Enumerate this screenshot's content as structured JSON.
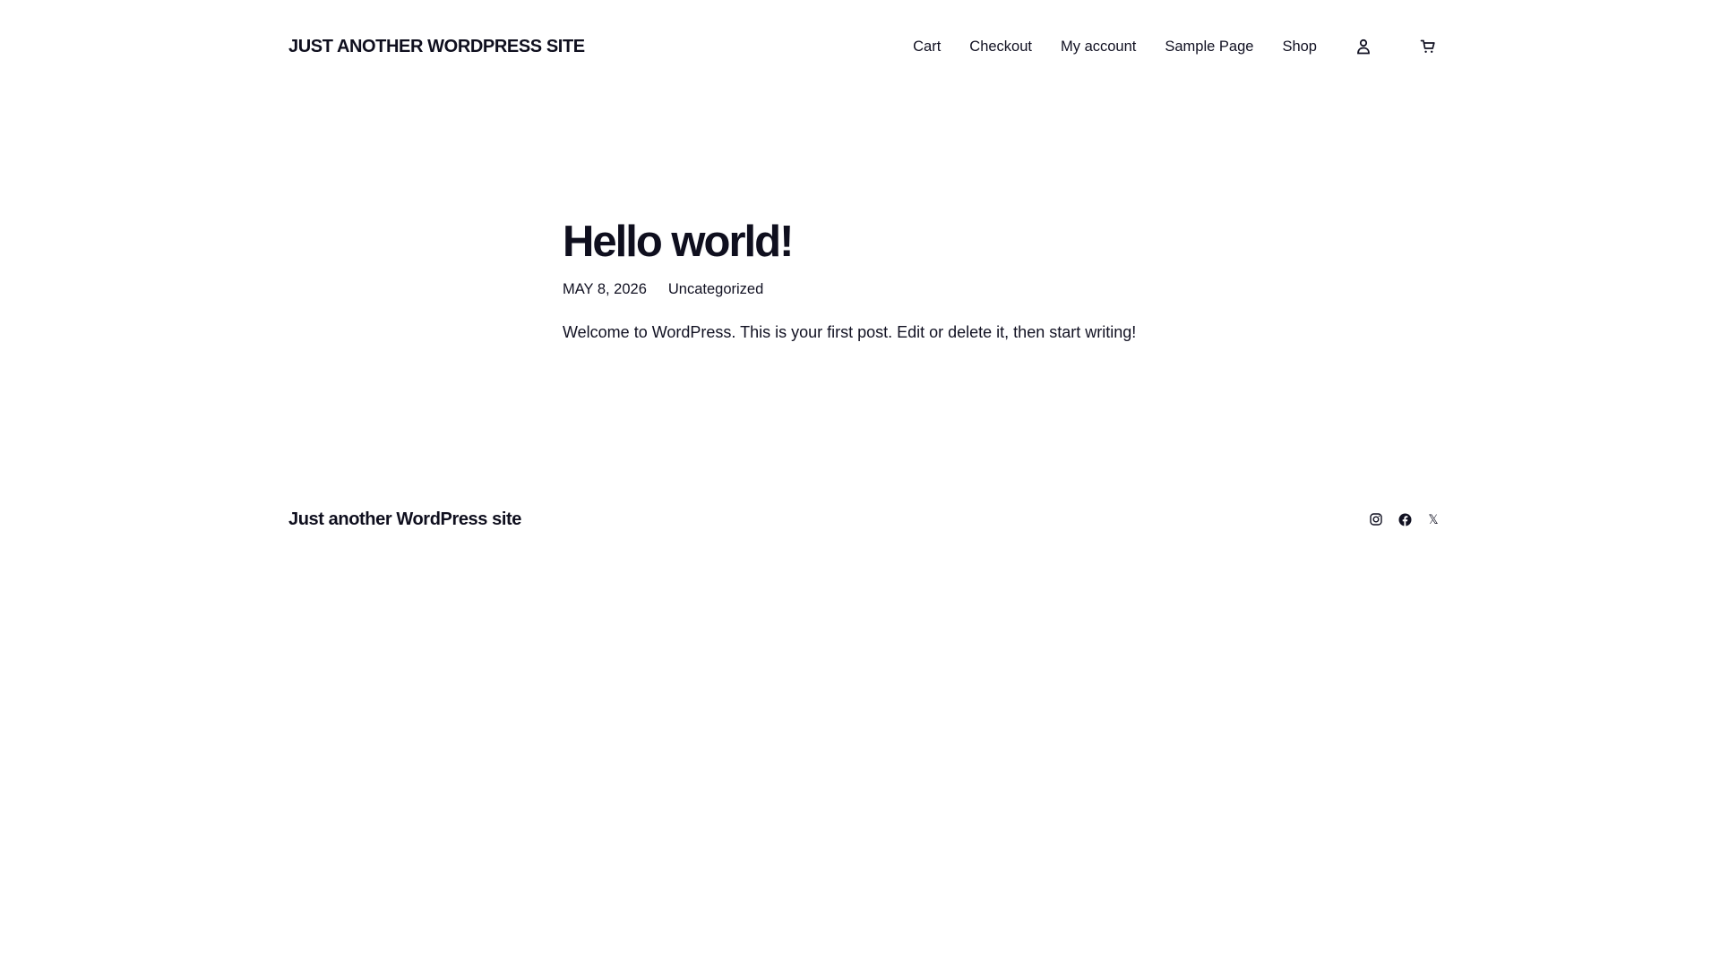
{
  "header": {
    "site_title": "JUST ANOTHER WORDPRESS SITE",
    "nav": [
      {
        "label": "Cart"
      },
      {
        "label": "Checkout"
      },
      {
        "label": "My account"
      },
      {
        "label": "Sample Page"
      },
      {
        "label": "Shop"
      }
    ],
    "icons": {
      "account": "user-icon",
      "cart": "cart-icon"
    }
  },
  "post": {
    "title": "Hello world!",
    "date": "MAY 8, 2026",
    "category": "Uncategorized",
    "excerpt": "Welcome to WordPress. This is your first post. Edit or delete it, then start writing!"
  },
  "footer": {
    "site_title": "Just another WordPress site",
    "social": [
      {
        "icon": "instagram-icon"
      },
      {
        "icon": "facebook-icon"
      },
      {
        "icon": "x-icon",
        "glyph": "𝕏"
      }
    ]
  },
  "colors": {
    "text": "#111122",
    "background": "#ffffff"
  }
}
